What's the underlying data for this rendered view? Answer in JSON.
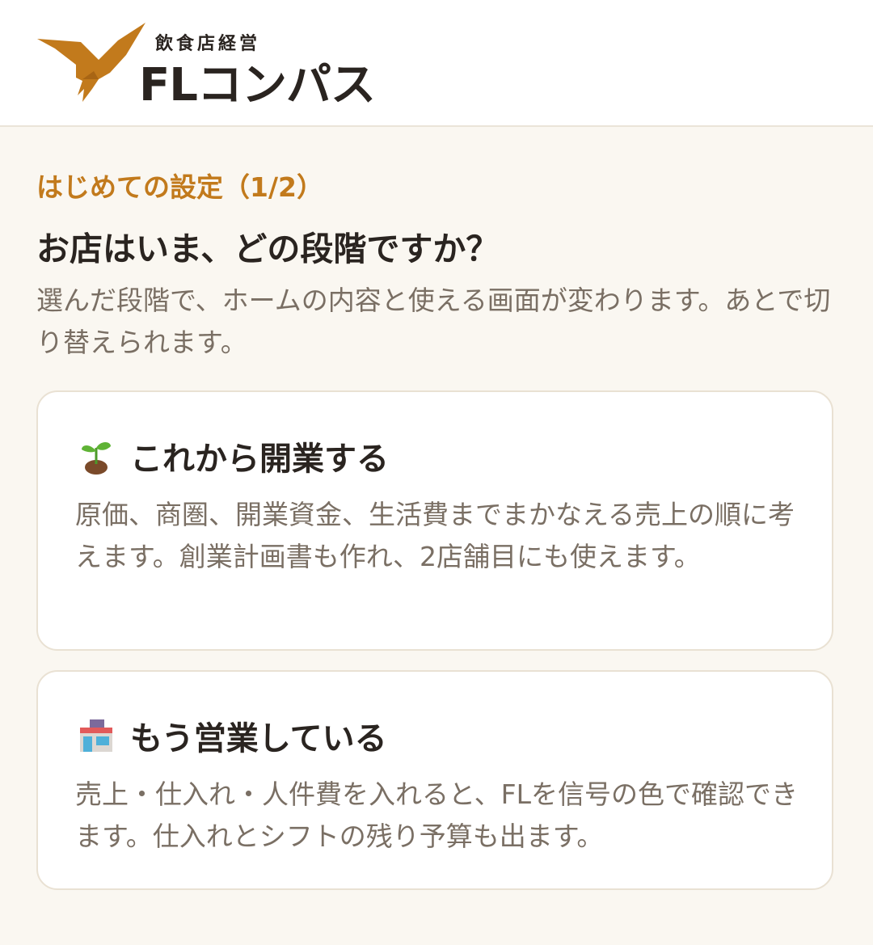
{
  "colors": {
    "accent": "#c27a1c",
    "text": "#2a2420",
    "muted": "#7a6f64",
    "background": "#faf7f1",
    "card_border": "#e9e1d3"
  },
  "header": {
    "logo_icon": "bird-logo-icon",
    "logo_subtitle": "飲食店経営",
    "logo_title": "FLコンパス"
  },
  "setup": {
    "step_label": "はじめての設定（1/2）",
    "question": "お店はいま、どの段階ですか？",
    "description": "選んだ段階で、ホームの内容と使える画面が変わります。あとで切り替えられます。"
  },
  "options": [
    {
      "icon": "seedling-icon",
      "title": "これから開業する",
      "body": "原価、商圏、開業資金、生活費までまかなえる売上の順に考えます。創業計画書も作れ、2店舗目にも使えます。"
    },
    {
      "icon": "convenience-store-icon",
      "title": "もう営業している",
      "body": "売上・仕入れ・人件費を入れると、FLを信号の色で確認できます。仕入れとシフトの残り予算も出ます。"
    }
  ]
}
